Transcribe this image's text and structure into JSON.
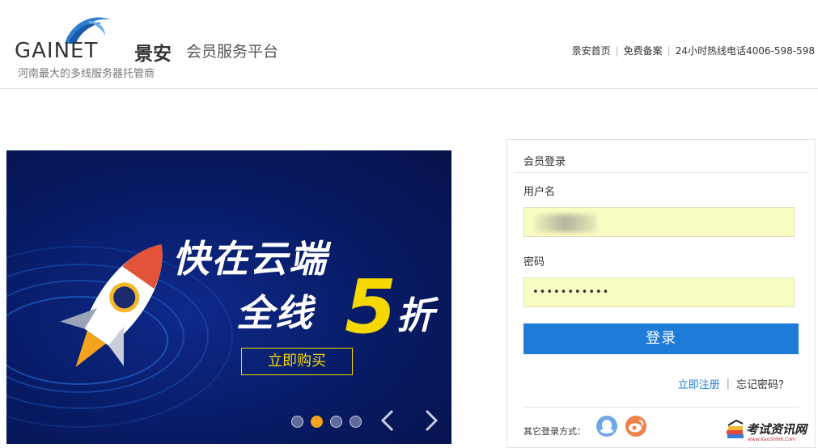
{
  "header": {
    "logo_word": "GAINET",
    "logo_cn": "景安",
    "platform": "会员服务平台",
    "tagline": "河南最大的多线服务器托管商",
    "links": [
      "景安首页",
      "免费备案",
      "24小时热线电话4006-598-598"
    ]
  },
  "banner": {
    "headline1": "快在云端",
    "headline2": "全线",
    "discount_number": "5",
    "discount_word": "折",
    "cta": "立即购买",
    "slides": 4,
    "active_slide": 2,
    "prev_icon": "chevron-left-icon",
    "next_icon": "chevron-right-icon"
  },
  "login": {
    "title": "会员登录",
    "username_label": "用户名",
    "username_value": "",
    "password_label": "密码",
    "password_value": "•••••••••••",
    "submit_label": "登录",
    "register_link": "立即注册",
    "forgot_link": "忘记密码？",
    "other_login_label": "其它登录方式：",
    "social": [
      "qq-icon",
      "weibo-icon"
    ]
  },
  "watermark": {
    "text": "考试资讯网",
    "sub": "www.KaoShi66.Com"
  },
  "colors": {
    "accent": "#1e7bd8",
    "banner_bg": "#071a63",
    "highlight": "#f5d800",
    "input_bg": "#fafdc2"
  }
}
